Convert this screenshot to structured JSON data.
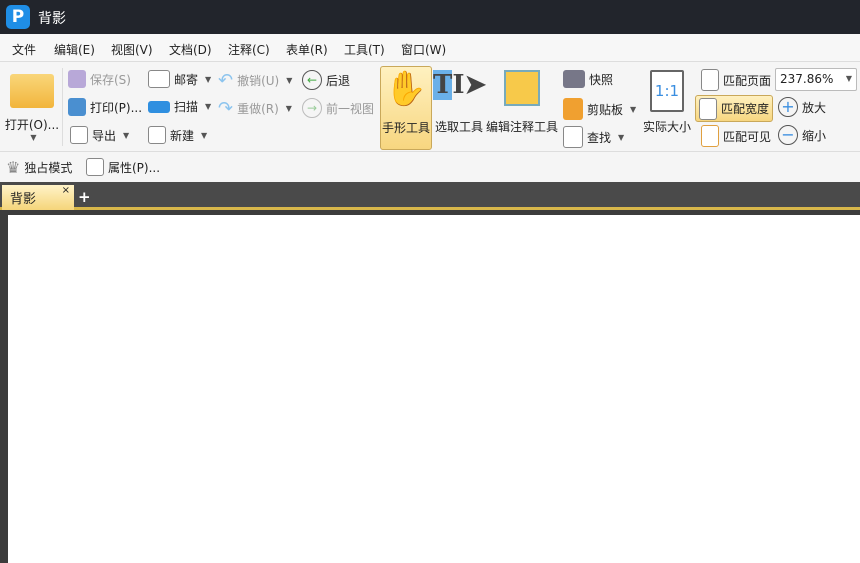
{
  "app": {
    "title": "背影",
    "logo": "P"
  },
  "menu": [
    "文件",
    "编辑(E)",
    "视图(V)",
    "文档(D)",
    "注释(C)",
    "表单(R)",
    "工具(T)",
    "窗口(W)"
  ],
  "toolbar": {
    "open": "打开(O)...",
    "save": "保存(S)",
    "print": "打印(P)...",
    "export": "导出",
    "mail": "邮寄",
    "scan": "扫描",
    "new": "新建",
    "undo": "撤销(U)",
    "redo": "重做(R)",
    "back": "后退",
    "prev_view": "前一视图",
    "hand": "手形工具",
    "select": "选取工具",
    "edit_annot": "编辑注释工具",
    "snapshot": "快照",
    "clipboard": "剪贴板",
    "find": "查找",
    "actual_size": "实际大小",
    "actual_glyph": "1:1",
    "fit_page": "匹配页面",
    "fit_width": "匹配宽度",
    "fit_visible": "匹配可见",
    "zoom_in": "放大",
    "zoom_out": "缩小",
    "zoom_value": "237.86%"
  },
  "row2": {
    "exclusive": "独占模式",
    "properties": "属性(P)..."
  },
  "tabs": [
    {
      "label": "背影",
      "close": "×"
    }
  ],
  "new_tab": "+"
}
